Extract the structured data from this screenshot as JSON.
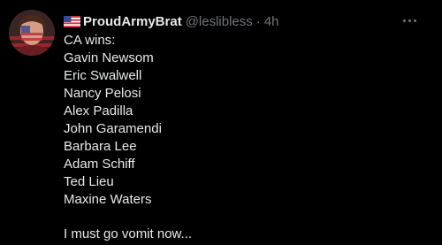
{
  "tweet": {
    "display_name": "ProudArmyBrat",
    "handle": "@leslibless",
    "separator": "·",
    "timestamp": "4h",
    "flag_icon": "us-flag-icon",
    "more_icon": "more-options-icon",
    "lines": [
      "CA wins:",
      "Gavin Newsom",
      "Eric Swalwell",
      "Nancy Pelosi",
      "Alex Padilla",
      "John Garamendi",
      "Barbara Lee",
      "Adam Schiff",
      "Ted Lieu",
      "Maxine Waters"
    ],
    "closing_line": "I must go vomit now..."
  },
  "colors": {
    "background": "#000000",
    "primary_text": "#e7e9ea",
    "secondary_text": "#71767b"
  }
}
